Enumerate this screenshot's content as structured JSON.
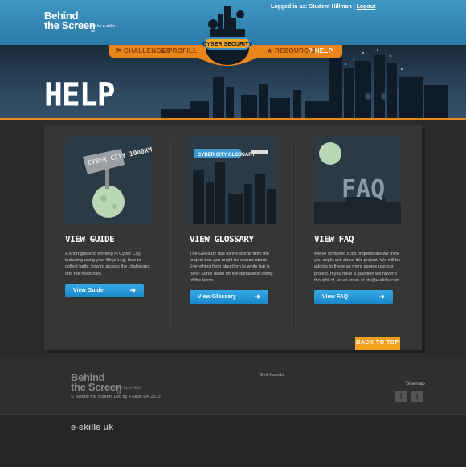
{
  "header": {
    "logo": {
      "line1": "Behind",
      "line2": "the Screen",
      "tagline": "led by e-skills uk"
    },
    "login": {
      "prefix": "Logged in as: Student Hillman",
      "separator": "|",
      "logout": "Logout"
    }
  },
  "nav": {
    "items": [
      {
        "label": "CHALLENGES",
        "icon": "challenges-icon"
      },
      {
        "label": "PROFILE",
        "icon": "profile-icon"
      },
      {
        "label": "RESOURCES",
        "icon": "star-icon"
      },
      {
        "label": "HELP",
        "icon": "question-icon",
        "active": true
      }
    ],
    "badge": "CYBER SECURITY"
  },
  "hero": {
    "title": "HELP"
  },
  "columns": [
    {
      "title": "VIEW GUIDE",
      "text": "A short guide to working in Cyber City, including using your Ninja Log, how to collect belts, how to access the challenges and the resources.",
      "button": "View Guide",
      "sign": "CYBER CITY 1000KM"
    },
    {
      "title": "VIEW GLOSSARY",
      "text": "The Glossary has all the words from the project that you might be unsure about. Everything from algorithm to white hat is here! Scroll down for the alphabetic listing of the terms.",
      "button": "View Glossary",
      "banner": "CYBER CITY GLOSSARY"
    },
    {
      "title": "VIEW FAQ",
      "text": "We've compiled a list of questions we think you might ask about this project. We will be adding to these as more people use our project. If you have a question we haven't thought of, let us know at bts@e-skills.com",
      "button": "View FAQ",
      "art": "FAQ"
    }
  ],
  "back_to_top": "BACK TO TOP",
  "footer": {
    "logo": {
      "line1": "Behind",
      "line2": "the Screen",
      "tagline": "led by e-skills uk"
    },
    "copyright": "© Behind the Screen, Led by e-skills UK 2013",
    "belt_awards": "Belt Awards",
    "sitemap": "Sitemap",
    "social": [
      {
        "name": "facebook-icon",
        "glyph": "f"
      },
      {
        "name": "twitter-icon",
        "glyph": "t"
      }
    ],
    "eskills": "e-skills uk"
  },
  "colors": {
    "accent": "#e8861b",
    "header_blue": "#2b79a6",
    "button_blue": "#1b86c8"
  }
}
